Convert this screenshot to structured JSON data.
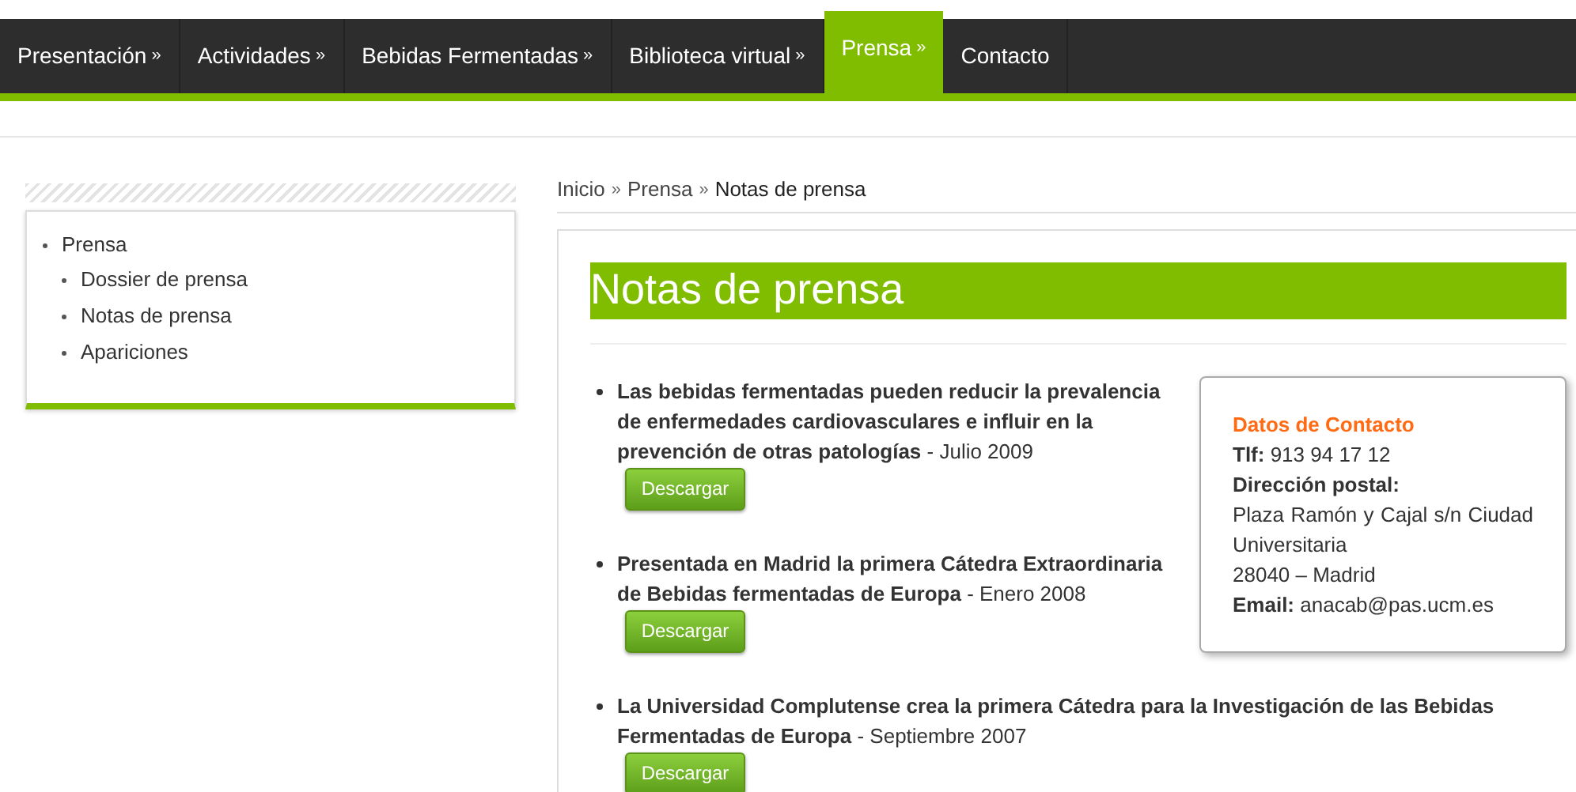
{
  "nav": [
    {
      "label": "Presentación",
      "arrow": "»",
      "selected": false
    },
    {
      "label": "Actividades",
      "arrow": "»",
      "selected": false
    },
    {
      "label": "Bebidas Fermentadas",
      "arrow": "»",
      "selected": false
    },
    {
      "label": "Biblioteca virtual",
      "arrow": "»",
      "selected": false
    },
    {
      "label": "Prensa",
      "arrow": "»",
      "selected": true
    },
    {
      "label": "Contacto",
      "selected": false
    }
  ],
  "sidebar": {
    "items": [
      {
        "label": "Prensa",
        "children": [
          {
            "label": "Dossier de prensa"
          },
          {
            "label": "Notas de prensa"
          },
          {
            "label": "Apariciones"
          }
        ]
      }
    ]
  },
  "breadcrumb": [
    {
      "label": "Inicio",
      "separator": "»"
    },
    {
      "label": "Prensa",
      "separator": "»"
    },
    {
      "label": "Notas de prensa"
    }
  ],
  "page_title": "Notas de prensa",
  "contact": {
    "heading": "Datos de Contacto",
    "lines": [
      "**Tlf:** 913 94 17 12",
      "**Dirección postal:**",
      "Plaza Ramón y Cajal s/n Ciudad Universitaria",
      "28040 – Madrid",
      "**Email:** anacab@pas.ucm.es"
    ]
  },
  "notes": [
    {
      "text": "**Las bebidas fermentadas pueden reducir la prevalencia de enfermedades cardiovasculares e influir en la prevención de otras patologías** - Julio 2009",
      "button": "Descargar"
    },
    {
      "text": "**Presentada en Madrid la primera Cátedra Extraordinaria de Bebidas fermentadas de Europa** - Enero 2008",
      "button": "Descargar"
    },
    {
      "text": "**La Universidad Complutense crea la primera Cátedra para la Investigación de las Bebidas Fermentadas de Europa** - Septiembre 2007",
      "button": "Descargar"
    }
  ]
}
